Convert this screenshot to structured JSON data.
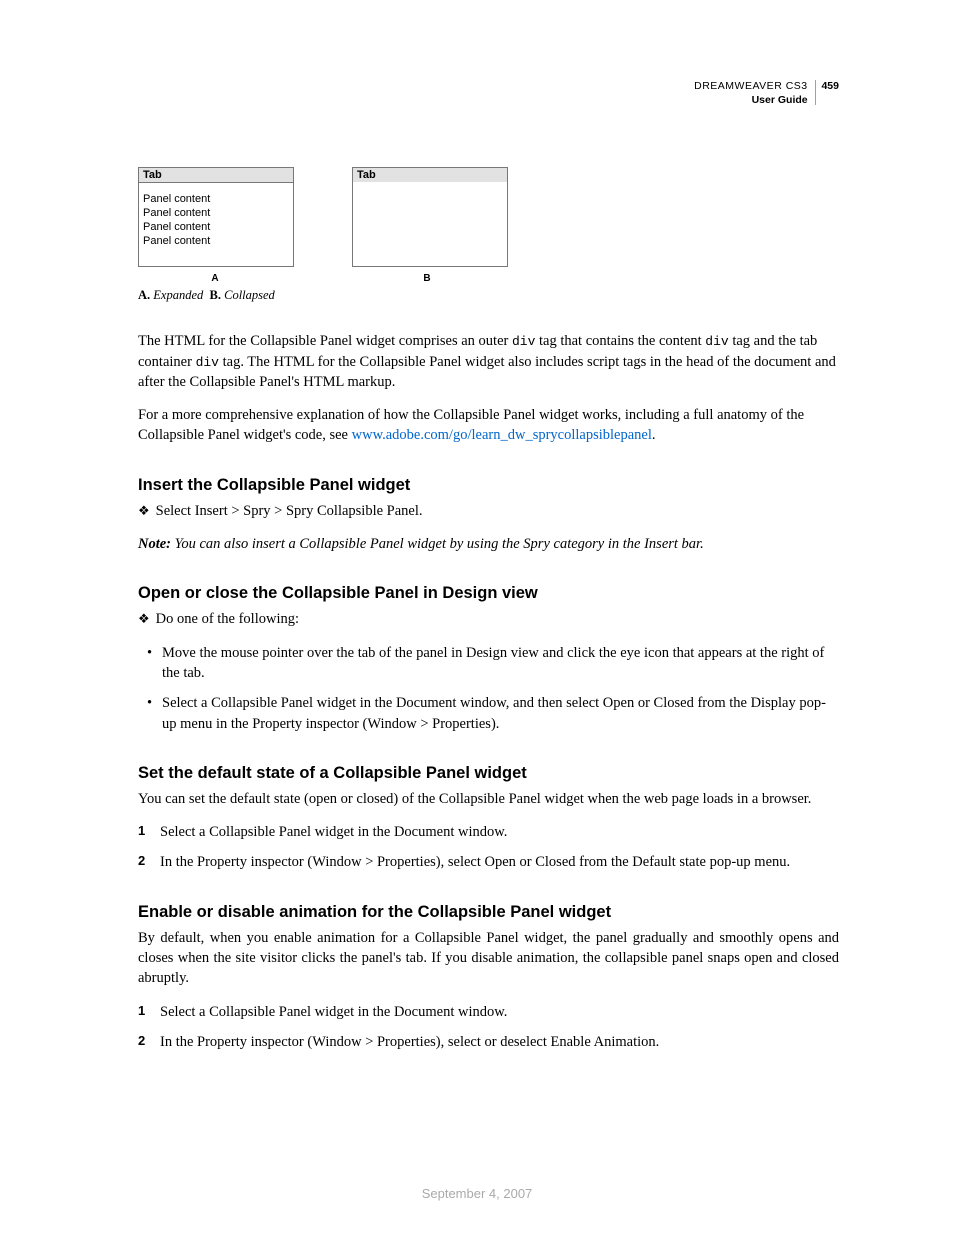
{
  "header": {
    "product": "DREAMWEAVER CS3",
    "page_number": "459",
    "guide": "User Guide"
  },
  "figure": {
    "tab_label": "Tab",
    "panel_line": "Panel content",
    "label_a": "A",
    "label_b": "B",
    "caption_a_key": "A.",
    "caption_a_val": "Expanded",
    "caption_b_key": "B.",
    "caption_b_val": "Collapsed"
  },
  "intro": {
    "p1_a": "The HTML for the Collapsible Panel widget comprises an outer ",
    "p1_code1": "div",
    "p1_b": " tag that contains the content ",
    "p1_code2": "div",
    "p1_c": " tag and the tab container ",
    "p1_code3": "div",
    "p1_d": " tag. The HTML for the Collapsible Panel widget also includes script tags in the head of the document and after the Collapsible Panel's HTML markup.",
    "p2_a": "For a more comprehensive explanation of how the Collapsible Panel widget works, including a full anatomy of the Collapsible Panel widget's code, see ",
    "p2_link": "www.adobe.com/go/learn_dw_sprycollapsiblepanel",
    "p2_b": "."
  },
  "sec_insert": {
    "heading": "Insert the Collapsible Panel widget",
    "step": "Select Insert > Spry > Spry Collapsible Panel.",
    "note_label": "Note:",
    "note_text": "You can also insert a Collapsible Panel widget by using the Spry category in the Insert bar."
  },
  "sec_open": {
    "heading": "Open or close the Collapsible Panel in Design view",
    "lead": "Do one of the following:",
    "b1": "Move the mouse pointer over the tab of the panel in Design view and click the eye icon that appears at the right of the tab.",
    "b2": "Select a Collapsible Panel widget in the Document window, and then select Open or Closed from the Display pop-up menu in the Property inspector (Window > Properties)."
  },
  "sec_default": {
    "heading": "Set the default state of a Collapsible Panel widget",
    "lead": "You can set the default state (open or closed) of the Collapsible Panel widget when the web page loads in a browser.",
    "s1": "Select a Collapsible Panel widget in the Document window.",
    "s2": "In the Property inspector (Window > Properties), select Open or Closed from the Default state pop-up menu."
  },
  "sec_anim": {
    "heading": "Enable or disable animation for the Collapsible Panel widget",
    "lead": "By default, when you enable animation for a Collapsible Panel widget, the panel gradually and smoothly opens and closes when the site visitor clicks the panel's tab. If you disable animation, the collapsible panel snaps open and closed abruptly.",
    "s1": "Select a Collapsible Panel widget in the Document window.",
    "s2": "In the Property inspector (Window > Properties), select or deselect Enable Animation."
  },
  "footer": {
    "date": "September 4, 2007"
  }
}
